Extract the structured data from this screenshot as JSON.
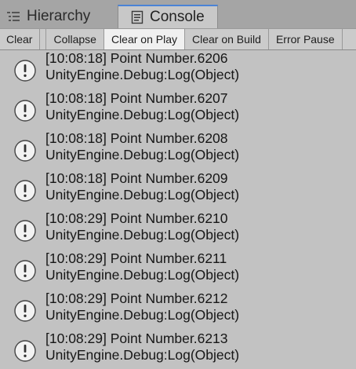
{
  "tabs": [
    {
      "label": "Hierarchy",
      "icon": "hierarchy-list-icon",
      "active": false
    },
    {
      "label": "Console",
      "icon": "console-icon",
      "active": true
    }
  ],
  "toolbar": {
    "clear": "Clear",
    "collapse": "Collapse",
    "clear_on_play": "Clear on Play",
    "clear_on_build": "Clear on Build",
    "error_pause": "Error Pause"
  },
  "entries": [
    {
      "line1": "[10:08:18] Point Number.6206",
      "line2": "UnityEngine.Debug:Log(Object)",
      "icon": "info-icon"
    },
    {
      "line1": "[10:08:18] Point Number.6207",
      "line2": "UnityEngine.Debug:Log(Object)",
      "icon": "info-icon"
    },
    {
      "line1": "[10:08:18] Point Number.6208",
      "line2": "UnityEngine.Debug:Log(Object)",
      "icon": "info-icon"
    },
    {
      "line1": "[10:08:18] Point Number.6209",
      "line2": "UnityEngine.Debug:Log(Object)",
      "icon": "info-icon"
    },
    {
      "line1": "[10:08:29] Point Number.6210",
      "line2": "UnityEngine.Debug:Log(Object)",
      "icon": "info-icon"
    },
    {
      "line1": "[10:08:29] Point Number.6211",
      "line2": "UnityEngine.Debug:Log(Object)",
      "icon": "info-icon"
    },
    {
      "line1": "[10:08:29] Point Number.6212",
      "line2": "UnityEngine.Debug:Log(Object)",
      "icon": "info-icon"
    },
    {
      "line1": "[10:08:29] Point Number.6213",
      "line2": "UnityEngine.Debug:Log(Object)",
      "icon": "info-icon"
    }
  ],
  "colors": {
    "tab_strip": "#a5a5a5",
    "active_tab": "#c8c8c8",
    "active_tab_accent": "#4a83d6",
    "panel_bg": "#c2c2c2",
    "toggle_on_bg": "#f0f0f0"
  }
}
